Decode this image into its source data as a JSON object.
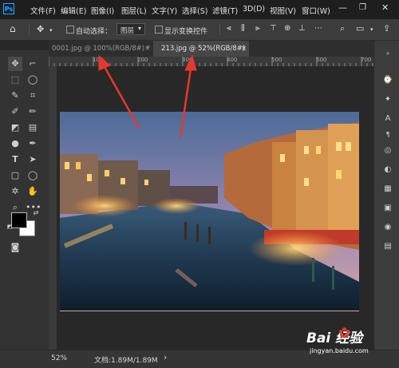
{
  "menu": {
    "logo": "Ps",
    "items": [
      "文件(F)",
      "编辑(E)",
      "图像(I)",
      "图层(L)",
      "文字(Y)",
      "选择(S)",
      "滤镜(T)",
      "3D(D)",
      "视图(V)",
      "窗口(W)"
    ]
  },
  "options": {
    "auto_select_label": "自动选择：",
    "layer_value": "图层",
    "show_transform_label": "显示变换控件"
  },
  "tabs": [
    {
      "label": "0001.jpg @ 100%(RGB/8#) *",
      "close": "×"
    },
    {
      "label": "213.jpg @ 52%(RGB/8#)",
      "close": "×"
    }
  ],
  "ruler": {
    "marks": [
      "100",
      "200",
      "300",
      "400",
      "500",
      "600",
      "700"
    ]
  },
  "status": {
    "zoom": "52%",
    "doc": "文档:1.89M/1.89M"
  },
  "watermark": {
    "brand": "Bai  经验",
    "url": "jingyan.baidu.com"
  },
  "colors": {
    "accent": "#31a8ff",
    "arrow": "#e8372c",
    "foreground": "#000000",
    "background": "#ffffff"
  }
}
